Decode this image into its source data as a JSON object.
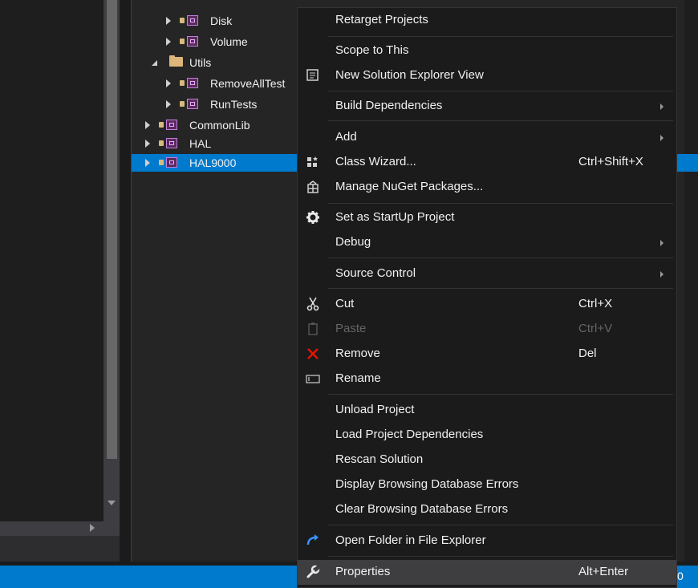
{
  "tree": {
    "items": [
      {
        "label": "Disk"
      },
      {
        "label": "Volume"
      },
      {
        "label": "Utils"
      },
      {
        "label": "RemoveAllTest"
      },
      {
        "label": "RunTests"
      },
      {
        "label": "CommonLib"
      },
      {
        "label": "HAL"
      },
      {
        "label": "HAL9000"
      }
    ]
  },
  "status": {
    "text": "0"
  },
  "menu": {
    "items": [
      {
        "label": "Retarget Projects"
      },
      {
        "label": "Scope to This"
      },
      {
        "label": "New Solution Explorer View",
        "icon": "new-view-icon"
      },
      {
        "label": "Build Dependencies",
        "submenu": true
      },
      {
        "label": "Add",
        "submenu": true
      },
      {
        "label": "Class Wizard...",
        "shortcut": "Ctrl+Shift+X",
        "icon": "class-wizard-icon"
      },
      {
        "label": "Manage NuGet Packages...",
        "icon": "nuget-icon"
      },
      {
        "label": "Set as StartUp Project",
        "icon": "gear-icon"
      },
      {
        "label": "Debug",
        "submenu": true
      },
      {
        "label": "Source Control",
        "submenu": true
      },
      {
        "label": "Cut",
        "shortcut": "Ctrl+X",
        "icon": "scissors-icon"
      },
      {
        "label": "Paste",
        "shortcut": "Ctrl+V",
        "icon": "clipboard-icon",
        "disabled": true
      },
      {
        "label": "Remove",
        "shortcut": "Del",
        "icon": "remove-icon"
      },
      {
        "label": "Rename",
        "icon": "rename-icon"
      },
      {
        "label": "Unload Project"
      },
      {
        "label": "Load Project Dependencies"
      },
      {
        "label": "Rescan Solution"
      },
      {
        "label": "Display Browsing Database Errors"
      },
      {
        "label": "Clear Browsing Database Errors"
      },
      {
        "label": "Open Folder in File Explorer",
        "icon": "open-folder-icon"
      },
      {
        "label": "Properties",
        "shortcut": "Alt+Enter",
        "icon": "wrench-icon",
        "highlighted": true
      }
    ]
  },
  "colors": {
    "accent": "#007acc",
    "remove": "#e51400",
    "folder": "#dcb67a"
  }
}
